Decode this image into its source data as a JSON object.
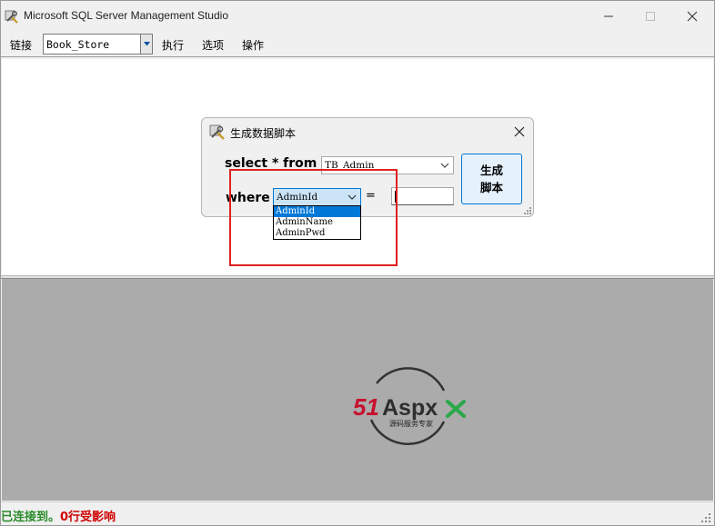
{
  "window": {
    "title": "Microsoft SQL Server Management Studio",
    "controls": {
      "minimize": "minimize",
      "maximize": "maximize",
      "close": "close"
    }
  },
  "menubar": {
    "connect_label": "链接",
    "database_select": "Book_Store",
    "items": [
      "执行",
      "选项",
      "操作"
    ]
  },
  "dialog": {
    "title": "生成数据脚本",
    "select_label": "select * from",
    "table_value": "TB_Admin",
    "where_label": "where",
    "column_value": "AdminId",
    "equals": "=",
    "value_text": "",
    "generate_button_line1": "生成",
    "generate_button_line2": "脚本",
    "column_options": [
      "AdminId",
      "AdminName",
      "AdminPwd"
    ]
  },
  "watermark": {
    "brand": "51Aspx",
    "subtitle": "源码服务专家"
  },
  "status": {
    "connected": "已连接到。",
    "rows": "0行受影响"
  },
  "colors": {
    "accent": "#0078d7",
    "status_ok": "#2a8a2a",
    "status_rows": "#d00000",
    "highlight": "#e02020",
    "results_bg": "#ababab"
  }
}
